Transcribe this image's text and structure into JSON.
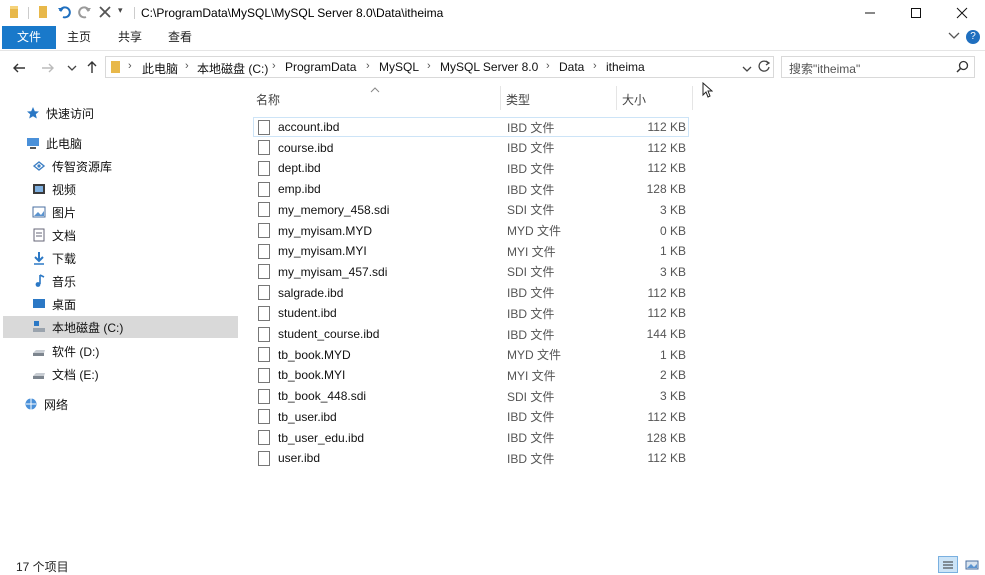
{
  "window": {
    "title": "C:\\ProgramData\\MySQL\\MySQL Server 8.0\\Data\\itheima",
    "minimize_icon": "minimize-icon",
    "maximize_icon": "maximize-icon",
    "close_icon": "close-icon"
  },
  "ribbon": {
    "tabs": [
      "文件",
      "主页",
      "共享",
      "查看"
    ],
    "file_tab_color": "#1979ca"
  },
  "address": {
    "breadcrumbs": [
      "此电脑",
      "本地磁盘 (C:)",
      "ProgramData",
      "MySQL",
      "MySQL Server 8.0",
      "Data",
      "itheima"
    ]
  },
  "search": {
    "placeholder": "搜索\"itheima\""
  },
  "nav": {
    "quick_access": "快速访问",
    "this_pc": "此电脑",
    "items": [
      "传智资源库",
      "视频",
      "图片",
      "文档",
      "下载",
      "音乐",
      "桌面",
      "本地磁盘 (C:)",
      "软件 (D:)",
      "文档 (E:)"
    ],
    "network": "网络",
    "selected": "本地磁盘 (C:)"
  },
  "columns": {
    "name": "名称",
    "type": "类型",
    "size": "大小"
  },
  "files": [
    {
      "name": "account.ibd",
      "type": "IBD 文件",
      "size": "112 KB"
    },
    {
      "name": "course.ibd",
      "type": "IBD 文件",
      "size": "112 KB"
    },
    {
      "name": "dept.ibd",
      "type": "IBD 文件",
      "size": "112 KB"
    },
    {
      "name": "emp.ibd",
      "type": "IBD 文件",
      "size": "128 KB"
    },
    {
      "name": "my_memory_458.sdi",
      "type": "SDI 文件",
      "size": "3 KB"
    },
    {
      "name": "my_myisam.MYD",
      "type": "MYD 文件",
      "size": "0 KB"
    },
    {
      "name": "my_myisam.MYI",
      "type": "MYI 文件",
      "size": "1 KB"
    },
    {
      "name": "my_myisam_457.sdi",
      "type": "SDI 文件",
      "size": "3 KB"
    },
    {
      "name": "salgrade.ibd",
      "type": "IBD 文件",
      "size": "112 KB"
    },
    {
      "name": "student.ibd",
      "type": "IBD 文件",
      "size": "112 KB"
    },
    {
      "name": "student_course.ibd",
      "type": "IBD 文件",
      "size": "144 KB"
    },
    {
      "name": "tb_book.MYD",
      "type": "MYD 文件",
      "size": "1 KB"
    },
    {
      "name": "tb_book.MYI",
      "type": "MYI 文件",
      "size": "2 KB"
    },
    {
      "name": "tb_book_448.sdi",
      "type": "SDI 文件",
      "size": "3 KB"
    },
    {
      "name": "tb_user.ibd",
      "type": "IBD 文件",
      "size": "112 KB"
    },
    {
      "name": "tb_user_edu.ibd",
      "type": "IBD 文件",
      "size": "128 KB"
    },
    {
      "name": "user.ibd",
      "type": "IBD 文件",
      "size": "112 KB"
    }
  ],
  "status": {
    "item_count": "17 个项目"
  }
}
